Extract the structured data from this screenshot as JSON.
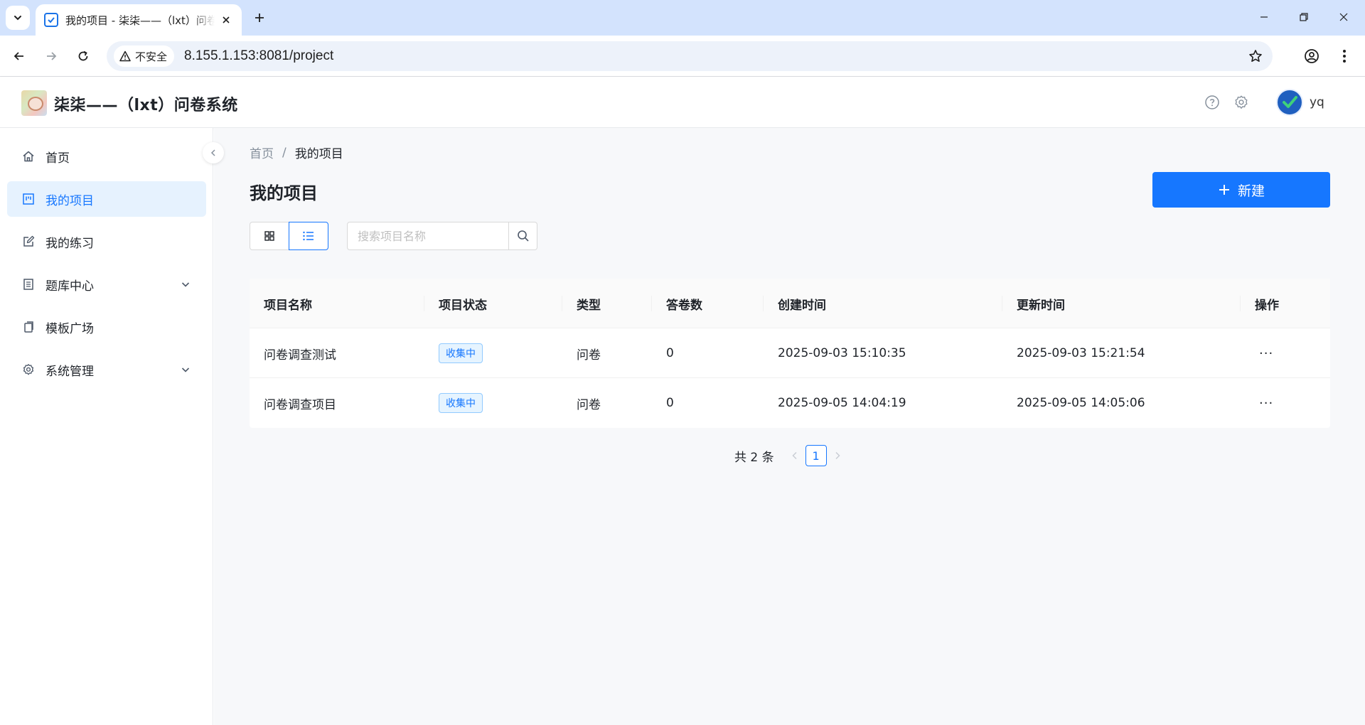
{
  "browser": {
    "tab_title": "我的项目 - 柒柒——（lxt）问卷系统",
    "security_label": "不安全",
    "url": "8.155.1.153:8081/project"
  },
  "header": {
    "app_title": "柒柒——（lxt）问卷系统",
    "user_name": "yq"
  },
  "sidebar": {
    "items": [
      {
        "label": "首页",
        "icon": "home-icon"
      },
      {
        "label": "我的项目",
        "icon": "project-icon",
        "active": true
      },
      {
        "label": "我的练习",
        "icon": "edit-icon"
      },
      {
        "label": "题库中心",
        "icon": "question-bank-icon",
        "expandable": true
      },
      {
        "label": "模板广场",
        "icon": "template-icon"
      },
      {
        "label": "系统管理",
        "icon": "gear-icon",
        "expandable": true
      }
    ]
  },
  "breadcrumb": {
    "home": "首页",
    "separator": "/",
    "current": "我的项目"
  },
  "page": {
    "title": "我的项目",
    "new_button": "新建",
    "search_placeholder": "搜索项目名称"
  },
  "table": {
    "columns": [
      "项目名称",
      "项目状态",
      "类型",
      "答卷数",
      "创建时间",
      "更新时间",
      "操作"
    ],
    "rows": [
      {
        "name": "问卷调查测试",
        "status": "收集中",
        "type": "问卷",
        "responses": "0",
        "created": "2025-09-03 15:10:35",
        "updated": "2025-09-03 15:21:54",
        "action": "···"
      },
      {
        "name": "问卷调查项目",
        "status": "收集中",
        "type": "问卷",
        "responses": "0",
        "created": "2025-09-05 14:04:19",
        "updated": "2025-09-05 14:05:06",
        "action": "···"
      }
    ]
  },
  "pagination": {
    "total": "共 2 条",
    "current_page": "1"
  },
  "colors": {
    "primary": "#1677ff",
    "active_bg": "#e6f2fe",
    "chrome_tabstrip": "#d3e3fd",
    "main_bg": "#f7f8fa"
  }
}
